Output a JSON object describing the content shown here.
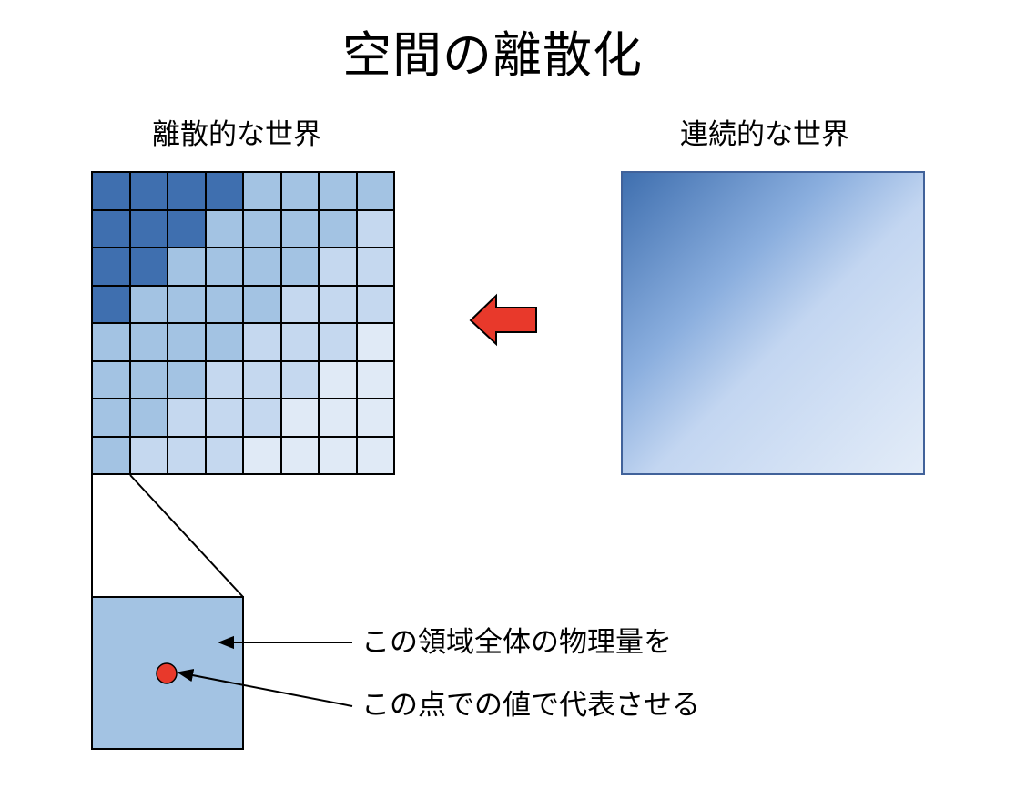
{
  "title": "空間の離散化",
  "labels": {
    "discrete": "離散的な世界",
    "continuous": "連続的な世界"
  },
  "notes": {
    "area": "この領域全体の物理量を",
    "point": "この点での値で代表させる"
  },
  "grid": {
    "rows": 8,
    "cols": 8,
    "levels": [
      [
        1,
        1,
        1,
        1,
        2,
        2,
        2,
        2
      ],
      [
        1,
        1,
        1,
        2,
        2,
        2,
        2,
        3
      ],
      [
        1,
        1,
        2,
        2,
        2,
        2,
        3,
        3
      ],
      [
        1,
        2,
        2,
        2,
        2,
        3,
        3,
        3
      ],
      [
        2,
        2,
        2,
        2,
        3,
        3,
        3,
        4
      ],
      [
        2,
        2,
        2,
        3,
        3,
        3,
        4,
        4
      ],
      [
        2,
        2,
        3,
        3,
        3,
        4,
        4,
        4
      ],
      [
        2,
        3,
        3,
        3,
        4,
        4,
        4,
        4
      ]
    ]
  },
  "colors": {
    "level_1": "#3f6faf",
    "level_2": "#a3c3e3",
    "level_3": "#c5d8ef",
    "level_4": "#e0eaf6",
    "gradient_start": "#3f6faf",
    "gradient_end": "#e3ecf8",
    "arrow_fill": "#e8392b",
    "arrow_stroke": "#000000",
    "zoom_cell": "#a3c3e3",
    "point_fill": "#e8392b"
  },
  "icons": {
    "transform_arrow": "left-arrow-icon",
    "representative_point": "red-dot-icon"
  }
}
